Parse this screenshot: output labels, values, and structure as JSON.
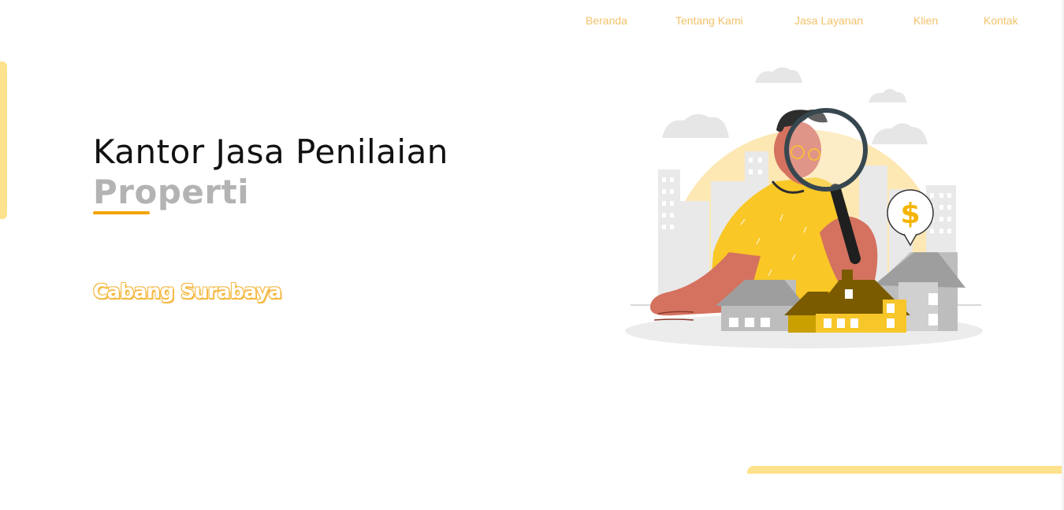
{
  "nav": {
    "items": [
      {
        "label": "Beranda"
      },
      {
        "label": "Tentang Kami"
      },
      {
        "label": "Jasa Layanan"
      },
      {
        "label": "Klien"
      },
      {
        "label": "Kontak"
      }
    ]
  },
  "hero": {
    "title": "Kantor Jasa Penilaian",
    "subtitle": "Properti",
    "branch": "Cabang Surabaya"
  },
  "illustration": {
    "description_icon": "property-appraisal-illustration",
    "coin_symbol": "$"
  },
  "colors": {
    "accent": "#f4a300",
    "nav_text": "#f2c26a",
    "accent_light": "#fde28e",
    "subtitle_grey": "#b3b3b3"
  }
}
